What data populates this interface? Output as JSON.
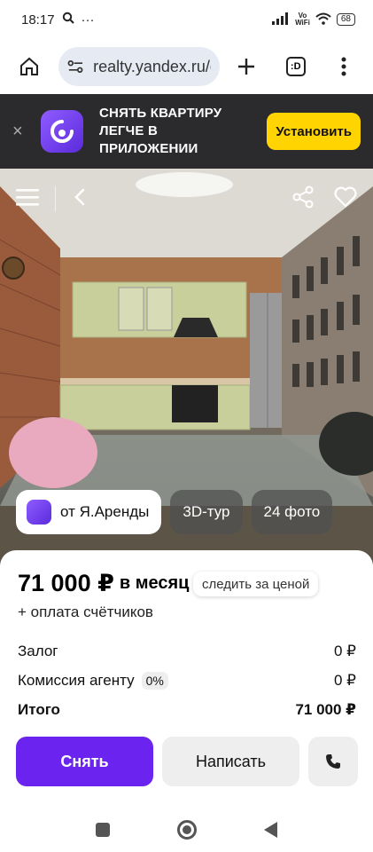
{
  "status": {
    "time": "18:17",
    "vowifi_top": "Vo",
    "vowifi_bottom": "WiFi",
    "battery": "68"
  },
  "browser": {
    "url": "realty.yandex.ru/c",
    "tab_count": ":D"
  },
  "banner": {
    "close": "×",
    "text": "Снять квартиру легче в приложении",
    "install_label": "Установить",
    "button_color": "#ffd400"
  },
  "photo": {
    "chip_source": "от Я.Аренды",
    "chip_tour": "3D-тур",
    "chip_photos": "24 фото"
  },
  "details": {
    "price": "71 000 ₽",
    "per_month": "в месяц",
    "watch_price": "следить за ценой",
    "meters_note": "+ оплата счётчиков",
    "rows": [
      {
        "label": "Залог",
        "value": "0 ₽"
      },
      {
        "label": "Комиссия агенту",
        "badge": "0%",
        "value": "0 ₽"
      },
      {
        "label": "Итого",
        "value": "71 000 ₽"
      }
    ],
    "rent_label": "Снять",
    "write_label": "Написать",
    "accent_color": "#6b24f0"
  }
}
